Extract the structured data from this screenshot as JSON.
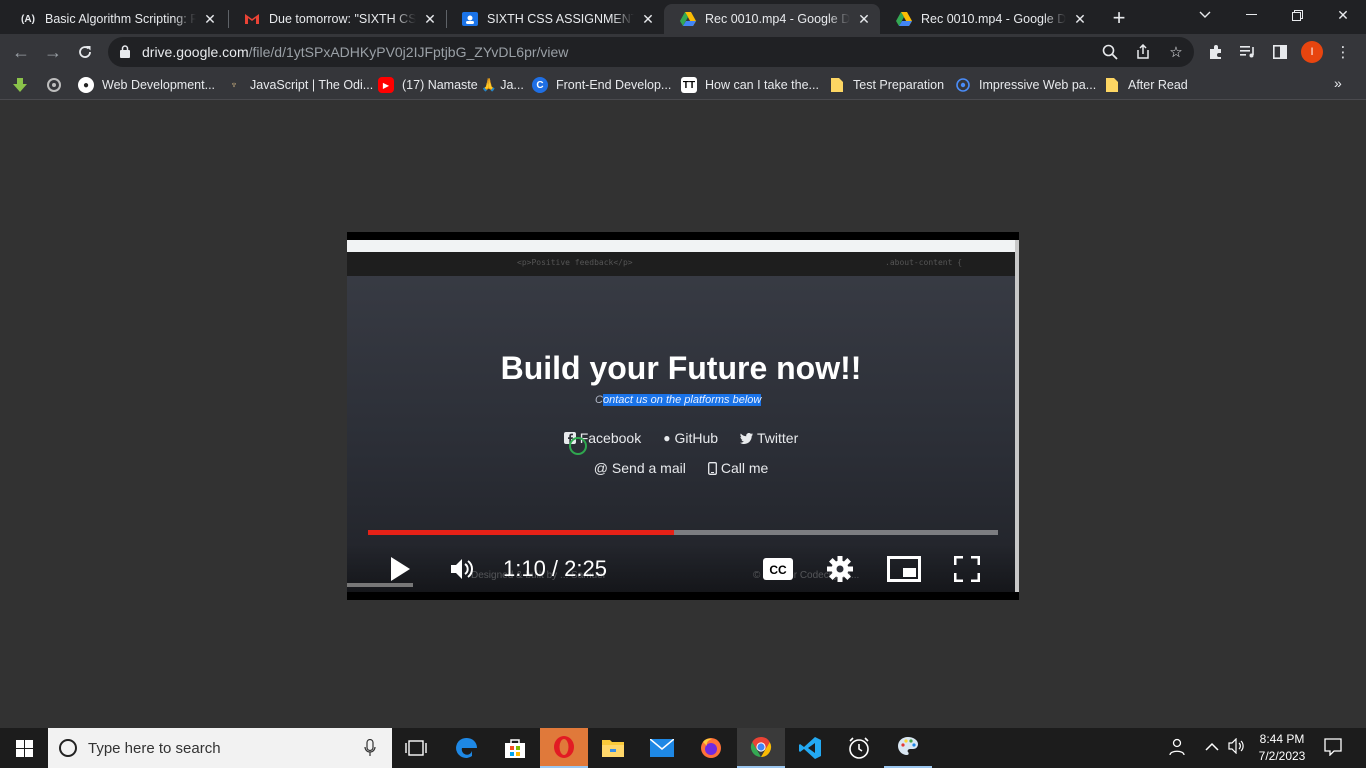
{
  "browser": {
    "tabs": [
      {
        "title": "Basic Algorithm Scripting: Re",
        "icon": "freecodecamp-icon",
        "active": false
      },
      {
        "title": "Due tomorrow: \"SIXTH CSS A",
        "icon": "gmail-icon",
        "active": false
      },
      {
        "title": "SIXTH CSS ASSIGNMENT",
        "icon": "classroom-icon",
        "active": false
      },
      {
        "title": "Rec 0010.mp4 - Google Drive",
        "icon": "google-drive-icon",
        "active": true
      },
      {
        "title": "Rec 0010.mp4 - Google Drive",
        "icon": "google-drive-icon",
        "active": false
      }
    ],
    "url_host": "drive.google.com",
    "url_path": "/file/d/1ytSPxADHKyPV0j2IJFptjbG_ZYvDL6pr/view",
    "profile_initial": "I",
    "bookmarks": [
      {
        "label": "Web Development...",
        "icon": "globe-icon"
      },
      {
        "label": "JavaScript | The Odi...",
        "icon": "odin-icon"
      },
      {
        "label": "(17) Namaste 🙏 Ja...",
        "icon": "youtube-icon"
      },
      {
        "label": "Front-End Develop...",
        "icon": "coursera-icon"
      },
      {
        "label": "How can I take the...",
        "icon": "stackoverflow-icon"
      },
      {
        "label": "Test Preparation",
        "icon": "folder-icon"
      },
      {
        "label": "Impressive Web pa...",
        "icon": "web-icon"
      },
      {
        "label": "After Read",
        "icon": "folder-icon"
      }
    ]
  },
  "video": {
    "hero_title": "Build your Future now!!",
    "hero_sub_prefix": "C",
    "hero_sub_selected": "ontact us on the platforms below",
    "links_row1": [
      "Facebook",
      "GitHub",
      "Twitter"
    ],
    "links_row2": [
      "Send a mail",
      "Call me"
    ],
    "code_snippet_1": "<p>Positive feedback</p>",
    "code_snippet_2": ".about-content {",
    "ghost_left": "Designed & built by ... Samuel",
    "ghost_right": "© ...ed for CodecityBa...",
    "time_current": "1:10",
    "time_total": "2:25",
    "time_display": "1:10 / 2:25",
    "progress": 0.485
  },
  "taskbar": {
    "search_placeholder": "Type here to search",
    "time": "8:44 PM",
    "date": "7/2/2023"
  }
}
